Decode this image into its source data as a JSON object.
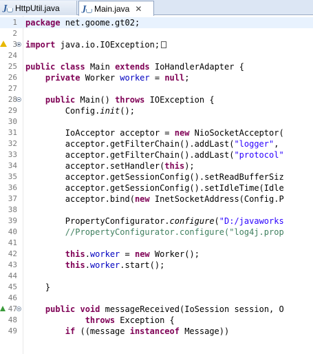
{
  "tabs": [
    {
      "label": "HttpUtil.java",
      "active": false
    },
    {
      "label": "Main.java",
      "active": true
    }
  ],
  "close_glyph": "✕",
  "editor": {
    "lines": [
      {
        "num": "1",
        "code": "package net.goome.gt02;"
      },
      {
        "num": "2",
        "code": ""
      },
      {
        "num": "3",
        "code": "import java.io.IOException;"
      },
      {
        "num": "24",
        "code": ""
      },
      {
        "num": "25",
        "code": "public class Main extends IoHandlerAdapter {"
      },
      {
        "num": "26",
        "code": "    private Worker worker = null;"
      },
      {
        "num": "27",
        "code": ""
      },
      {
        "num": "28",
        "code": "    public Main() throws IOException {"
      },
      {
        "num": "29",
        "code": "        Config.init();"
      },
      {
        "num": "30",
        "code": ""
      },
      {
        "num": "31",
        "code": "        IoAcceptor acceptor = new NioSocketAcceptor("
      },
      {
        "num": "32",
        "code": "        acceptor.getFilterChain().addLast(\"logger\", "
      },
      {
        "num": "33",
        "code": "        acceptor.getFilterChain().addLast(\"protocol\""
      },
      {
        "num": "34",
        "code": "        acceptor.setHandler(this);"
      },
      {
        "num": "35",
        "code": "        acceptor.getSessionConfig().setReadBufferSiz"
      },
      {
        "num": "36",
        "code": "        acceptor.getSessionConfig().setIdleTime(Idle"
      },
      {
        "num": "37",
        "code": "        acceptor.bind(new InetSocketAddress(Config.P"
      },
      {
        "num": "38",
        "code": ""
      },
      {
        "num": "39",
        "code": "        PropertyConfigurator.configure(\"D:/javaworks"
      },
      {
        "num": "40",
        "code": "        //PropertyConfigurator.configure(\"log4j.prop"
      },
      {
        "num": "41",
        "code": ""
      },
      {
        "num": "42",
        "code": "        this.worker = new Worker();"
      },
      {
        "num": "43",
        "code": "        this.worker.start();"
      },
      {
        "num": "44",
        "code": ""
      },
      {
        "num": "45",
        "code": "    }"
      },
      {
        "num": "46",
        "code": ""
      },
      {
        "num": "47",
        "code": "    public void messageReceived(IoSession session, O"
      },
      {
        "num": "48",
        "code": "            throws Exception {"
      },
      {
        "num": "49",
        "code": "        if ((message instanceof Message))"
      }
    ]
  },
  "colors": {
    "keyword": "#7f0055",
    "string": "#2a00ff",
    "field": "#0000c0",
    "comment": "#3f7f5f",
    "current_line": "#e8f2fe"
  }
}
